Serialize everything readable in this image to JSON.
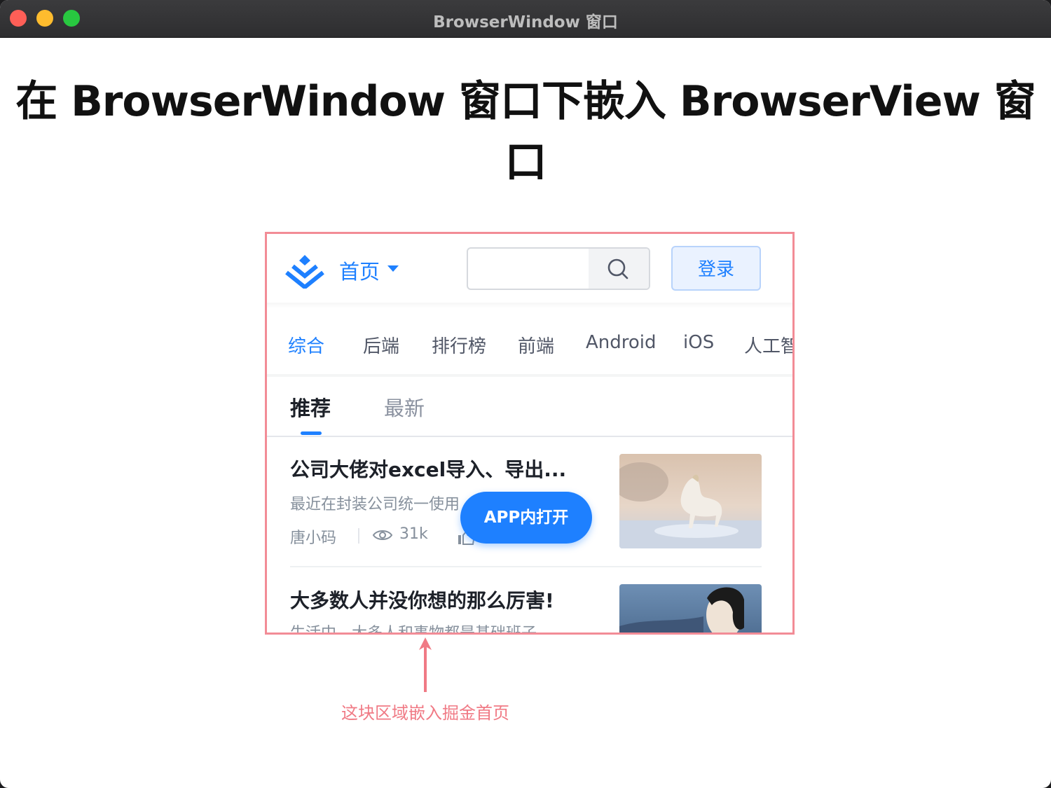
{
  "window": {
    "title": "BrowserWindow 窗口"
  },
  "heading": "在 BrowserWindow 窗口下嵌入 BrowserView 窗口",
  "embed": {
    "header": {
      "home_label": "首页",
      "search_placeholder": "",
      "login_label": "登录"
    },
    "categories": [
      {
        "label": "综合",
        "active": true
      },
      {
        "label": "后端",
        "active": false
      },
      {
        "label": "排行榜",
        "active": false
      },
      {
        "label": "前端",
        "active": false
      },
      {
        "label": "Android",
        "active": false
      },
      {
        "label": "iOS",
        "active": false
      },
      {
        "label": "人工智",
        "active": false
      }
    ],
    "sub_tabs": [
      {
        "label": "推荐",
        "active": true
      },
      {
        "label": "最新",
        "active": false
      }
    ],
    "articles": [
      {
        "title": "公司大佬对excel导入、导出...",
        "description": "最近在封装公司统一使用",
        "author": "唐小码",
        "views": "31k"
      },
      {
        "title": "大多数人并没你想的那么厉害!",
        "description": "生活中，大多人和事物都是基础班子",
        "author": "",
        "views": ""
      }
    ],
    "open_in_app_label": "APP内打开"
  },
  "annotation": {
    "caption": "这块区域嵌入掘金首页"
  },
  "colors": {
    "brand_blue": "#1e80ff",
    "highlight_border": "#f28c96",
    "annotation_text": "#f07a85"
  }
}
